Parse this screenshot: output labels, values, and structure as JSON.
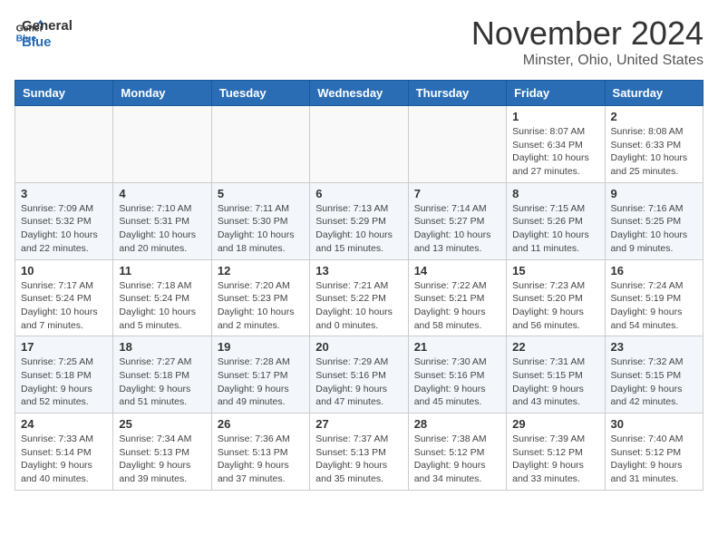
{
  "header": {
    "logo_line1": "General",
    "logo_line2": "Blue",
    "month": "November 2024",
    "location": "Minster, Ohio, United States"
  },
  "days_of_week": [
    "Sunday",
    "Monday",
    "Tuesday",
    "Wednesday",
    "Thursday",
    "Friday",
    "Saturday"
  ],
  "weeks": [
    [
      {
        "day": "",
        "info": ""
      },
      {
        "day": "",
        "info": ""
      },
      {
        "day": "",
        "info": ""
      },
      {
        "day": "",
        "info": ""
      },
      {
        "day": "",
        "info": ""
      },
      {
        "day": "1",
        "info": "Sunrise: 8:07 AM\nSunset: 6:34 PM\nDaylight: 10 hours and 27 minutes."
      },
      {
        "day": "2",
        "info": "Sunrise: 8:08 AM\nSunset: 6:33 PM\nDaylight: 10 hours and 25 minutes."
      }
    ],
    [
      {
        "day": "3",
        "info": "Sunrise: 7:09 AM\nSunset: 5:32 PM\nDaylight: 10 hours and 22 minutes."
      },
      {
        "day": "4",
        "info": "Sunrise: 7:10 AM\nSunset: 5:31 PM\nDaylight: 10 hours and 20 minutes."
      },
      {
        "day": "5",
        "info": "Sunrise: 7:11 AM\nSunset: 5:30 PM\nDaylight: 10 hours and 18 minutes."
      },
      {
        "day": "6",
        "info": "Sunrise: 7:13 AM\nSunset: 5:29 PM\nDaylight: 10 hours and 15 minutes."
      },
      {
        "day": "7",
        "info": "Sunrise: 7:14 AM\nSunset: 5:27 PM\nDaylight: 10 hours and 13 minutes."
      },
      {
        "day": "8",
        "info": "Sunrise: 7:15 AM\nSunset: 5:26 PM\nDaylight: 10 hours and 11 minutes."
      },
      {
        "day": "9",
        "info": "Sunrise: 7:16 AM\nSunset: 5:25 PM\nDaylight: 10 hours and 9 minutes."
      }
    ],
    [
      {
        "day": "10",
        "info": "Sunrise: 7:17 AM\nSunset: 5:24 PM\nDaylight: 10 hours and 7 minutes."
      },
      {
        "day": "11",
        "info": "Sunrise: 7:18 AM\nSunset: 5:24 PM\nDaylight: 10 hours and 5 minutes."
      },
      {
        "day": "12",
        "info": "Sunrise: 7:20 AM\nSunset: 5:23 PM\nDaylight: 10 hours and 2 minutes."
      },
      {
        "day": "13",
        "info": "Sunrise: 7:21 AM\nSunset: 5:22 PM\nDaylight: 10 hours and 0 minutes."
      },
      {
        "day": "14",
        "info": "Sunrise: 7:22 AM\nSunset: 5:21 PM\nDaylight: 9 hours and 58 minutes."
      },
      {
        "day": "15",
        "info": "Sunrise: 7:23 AM\nSunset: 5:20 PM\nDaylight: 9 hours and 56 minutes."
      },
      {
        "day": "16",
        "info": "Sunrise: 7:24 AM\nSunset: 5:19 PM\nDaylight: 9 hours and 54 minutes."
      }
    ],
    [
      {
        "day": "17",
        "info": "Sunrise: 7:25 AM\nSunset: 5:18 PM\nDaylight: 9 hours and 52 minutes."
      },
      {
        "day": "18",
        "info": "Sunrise: 7:27 AM\nSunset: 5:18 PM\nDaylight: 9 hours and 51 minutes."
      },
      {
        "day": "19",
        "info": "Sunrise: 7:28 AM\nSunset: 5:17 PM\nDaylight: 9 hours and 49 minutes."
      },
      {
        "day": "20",
        "info": "Sunrise: 7:29 AM\nSunset: 5:16 PM\nDaylight: 9 hours and 47 minutes."
      },
      {
        "day": "21",
        "info": "Sunrise: 7:30 AM\nSunset: 5:16 PM\nDaylight: 9 hours and 45 minutes."
      },
      {
        "day": "22",
        "info": "Sunrise: 7:31 AM\nSunset: 5:15 PM\nDaylight: 9 hours and 43 minutes."
      },
      {
        "day": "23",
        "info": "Sunrise: 7:32 AM\nSunset: 5:15 PM\nDaylight: 9 hours and 42 minutes."
      }
    ],
    [
      {
        "day": "24",
        "info": "Sunrise: 7:33 AM\nSunset: 5:14 PM\nDaylight: 9 hours and 40 minutes."
      },
      {
        "day": "25",
        "info": "Sunrise: 7:34 AM\nSunset: 5:13 PM\nDaylight: 9 hours and 39 minutes."
      },
      {
        "day": "26",
        "info": "Sunrise: 7:36 AM\nSunset: 5:13 PM\nDaylight: 9 hours and 37 minutes."
      },
      {
        "day": "27",
        "info": "Sunrise: 7:37 AM\nSunset: 5:13 PM\nDaylight: 9 hours and 35 minutes."
      },
      {
        "day": "28",
        "info": "Sunrise: 7:38 AM\nSunset: 5:12 PM\nDaylight: 9 hours and 34 minutes."
      },
      {
        "day": "29",
        "info": "Sunrise: 7:39 AM\nSunset: 5:12 PM\nDaylight: 9 hours and 33 minutes."
      },
      {
        "day": "30",
        "info": "Sunrise: 7:40 AM\nSunset: 5:12 PM\nDaylight: 9 hours and 31 minutes."
      }
    ]
  ]
}
